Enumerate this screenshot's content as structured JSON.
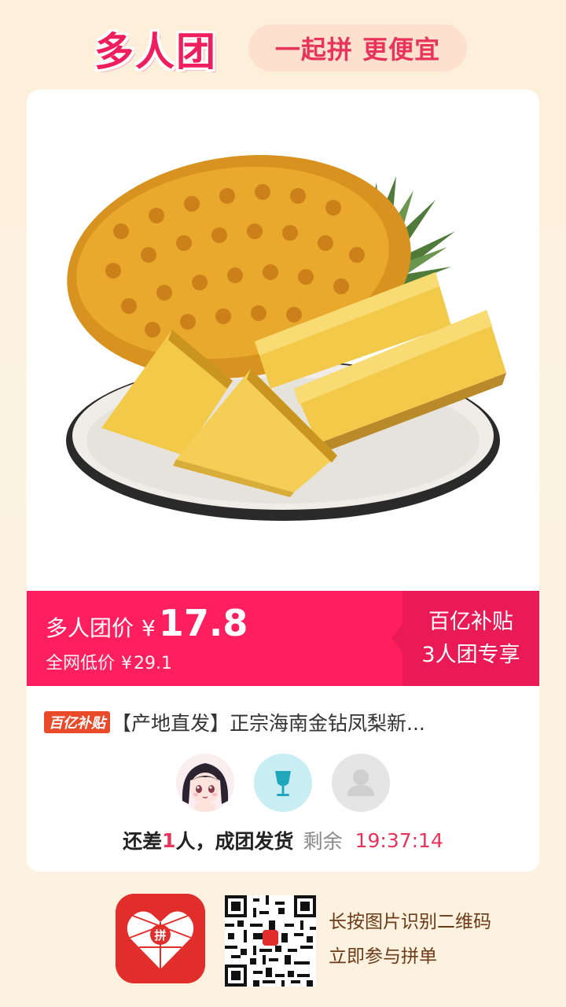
{
  "header": {
    "logo": "多人团",
    "slogan": "一起拼 更便宜"
  },
  "product": {
    "image_name": "pineapple-on-plate",
    "badge": "百亿补贴",
    "title": "【产地直发】正宗海南金钻凤梨新..."
  },
  "price_bar": {
    "label": "多人团价",
    "currency": "¥",
    "price": "17.8",
    "original_label": "全网低价",
    "original_currency": "¥",
    "original_price": "29.1",
    "promo_line1": "百亿补贴",
    "promo_line2": "3人团专享"
  },
  "group": {
    "avatars": [
      "avatar-cartoon-girl",
      "avatar-cup",
      "avatar-placeholder"
    ],
    "status_prefix": "还差",
    "missing_count": "1",
    "status_suffix": " 人，成团发货",
    "remaining_label": "剩余",
    "timer": "19:37:14"
  },
  "footer": {
    "app_icon": "pinduoduo-app-icon",
    "scan_line1": "长按图片识别二维码",
    "scan_line2": "立即参与拼单"
  },
  "colors": {
    "brand_pink": "#ff1f5e",
    "accent_red": "#e8335b",
    "background": "#fdefd9"
  }
}
